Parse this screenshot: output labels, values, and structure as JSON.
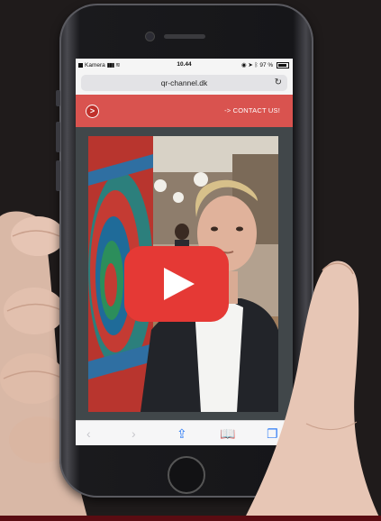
{
  "status_bar": {
    "carrier": "Kamera",
    "time": "10.44",
    "battery": "97 %"
  },
  "browser": {
    "url": "qr-channel.dk",
    "reload_icon": "reload-icon"
  },
  "header": {
    "logo_glyph": ">",
    "contact_link": "-> CONTACT US!",
    "accent_color": "#d9534f"
  },
  "video": {
    "play_icon": "youtube-play-icon",
    "play_color": "#e53935"
  },
  "toolbar": {
    "icons": [
      "back-icon",
      "forward-icon",
      "share-icon",
      "bookmarks-icon",
      "tabs-icon"
    ]
  }
}
